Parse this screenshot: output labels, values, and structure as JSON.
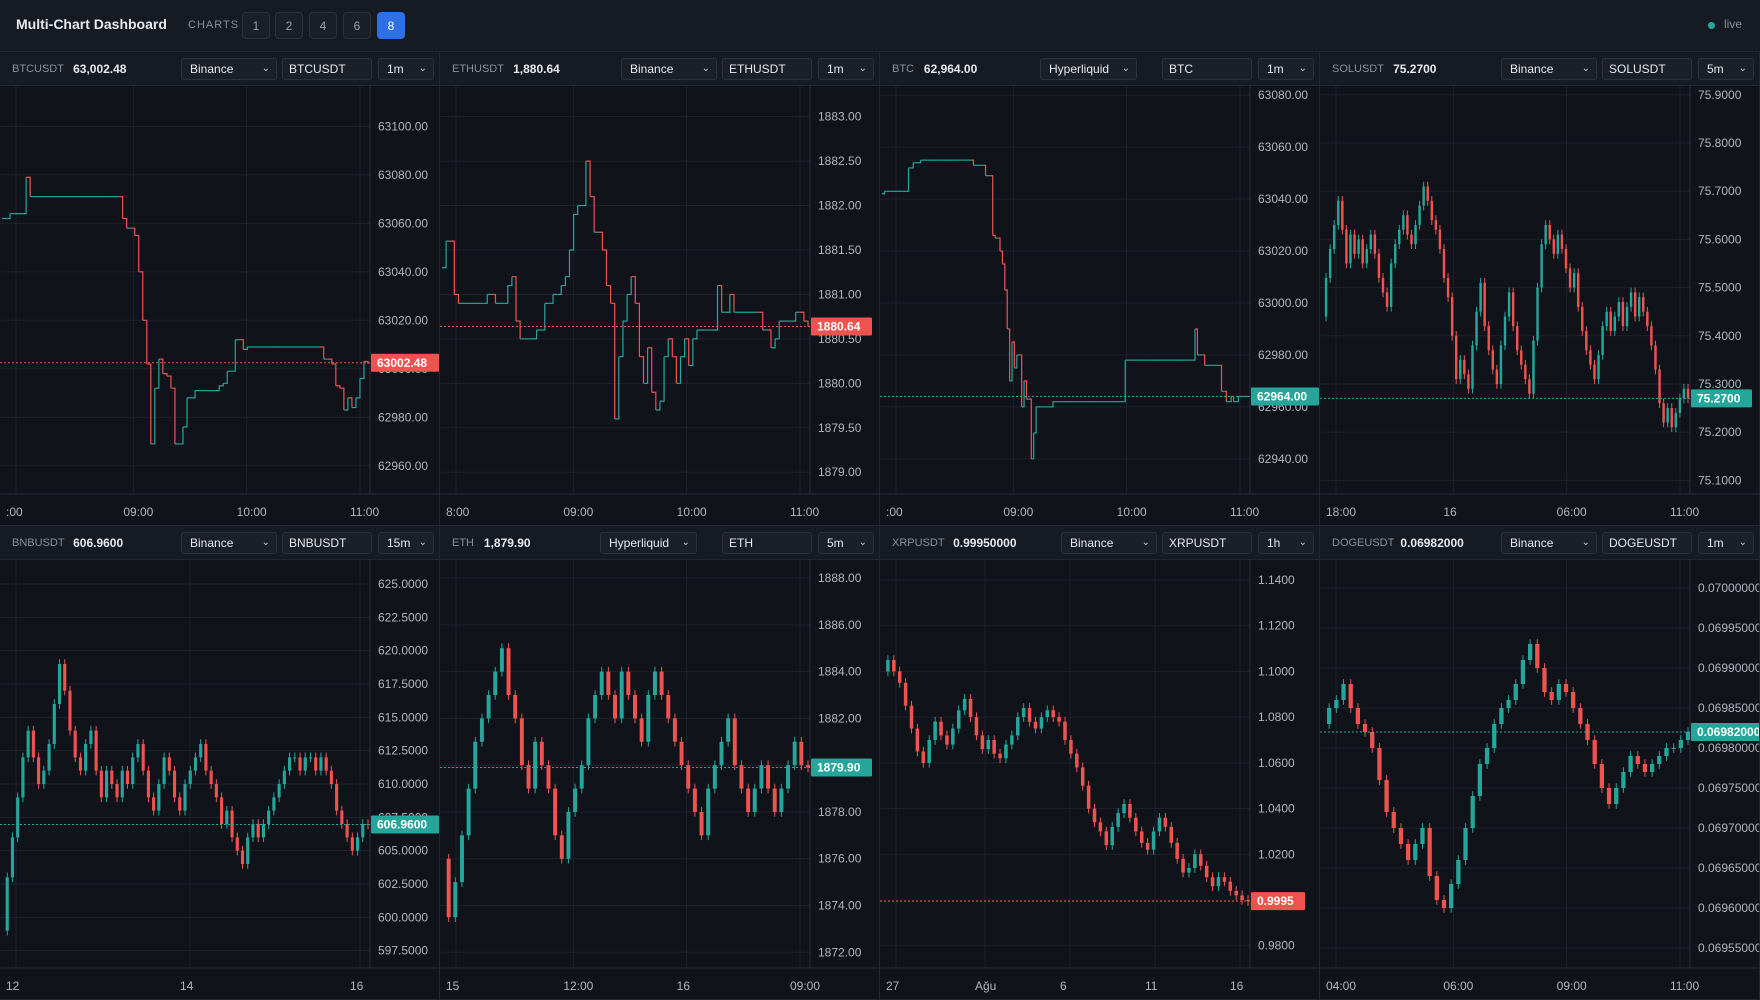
{
  "app": {
    "title": "Multi-Chart Dashboard",
    "charts_label": "CHARTS",
    "counts": [
      "1",
      "2",
      "4",
      "6",
      "8"
    ],
    "active_count": "8",
    "status": "live"
  },
  "colors": {
    "up": "#26a69a",
    "down": "#ef5350",
    "bg": "#10131a",
    "grid": "#1e222d",
    "axis_text": "#b2b5be",
    "accent": "#2f6fe8"
  },
  "chart_data": [
    {
      "type": "line",
      "style": "step",
      "symbol": "BTCUSDT",
      "last": "63,002.48",
      "exchange": "Binance",
      "input": "BTCUSDT",
      "timeframe": "1m",
      "y_ticks": [
        "63100.00",
        "63080.00",
        "63060.00",
        "63040.00",
        "63020.00",
        "63000.00",
        "62980.00",
        "62960.00"
      ],
      "ylim": [
        62950,
        63115
      ],
      "x_ticks": [
        ":00",
        "09:00",
        "10:00",
        "11:00"
      ],
      "price_label": "63002.48",
      "price_value": 63002.48,
      "price_dir": "down",
      "values": [
        63062,
        63062,
        63064,
        63064,
        63064,
        63064,
        63079,
        63071,
        63071,
        63071,
        63071,
        63071,
        63071,
        63071,
        63071,
        63071,
        63071,
        63071,
        63071,
        63071,
        63071,
        63071,
        63071,
        63071,
        63071,
        63071,
        63071,
        63071,
        63071,
        63071,
        63062,
        63058,
        63058,
        63055,
        63040,
        63020,
        63002,
        62969,
        62992,
        63004,
        62998,
        62997,
        62992,
        62969,
        62969,
        62976,
        62988,
        62988,
        62991,
        62991,
        62991,
        62991,
        62991,
        62991,
        62993,
        62994,
        62999,
        62999,
        63012,
        63012,
        63008,
        63009,
        63009,
        63009,
        63009,
        63009,
        63009,
        63009,
        63009,
        63009,
        63009,
        63009,
        63009,
        63009,
        63009,
        63009,
        63009,
        63009,
        63009,
        63009,
        63004,
        63004,
        63002,
        62993,
        62992,
        62983,
        62988,
        62984,
        62988,
        62996,
        63003,
        63002
      ]
    },
    {
      "type": "line",
      "style": "step",
      "symbol": "ETHUSDT",
      "last": "1,880.64",
      "exchange": "Binance",
      "input": "ETHUSDT",
      "timeframe": "1m",
      "y_ticks": [
        "1883.00",
        "1882.50",
        "1882.00",
        "1881.50",
        "1881.00",
        "1880.50",
        "1880.00",
        "1879.50",
        "1879.00"
      ],
      "ylim": [
        1878.8,
        1883.3
      ],
      "x_ticks": [
        "8:00",
        "09:00",
        "10:00",
        "11:00"
      ],
      "price_label": "1880.64",
      "price_value": 1880.64,
      "price_dir": "down",
      "values": [
        1881.3,
        1881.6,
        1881.6,
        1881.0,
        1880.9,
        1880.9,
        1880.9,
        1880.9,
        1880.9,
        1880.9,
        1880.9,
        1881.0,
        1881.0,
        1880.9,
        1880.9,
        1880.9,
        1881.1,
        1881.2,
        1880.7,
        1880.5,
        1880.5,
        1880.5,
        1880.5,
        1880.6,
        1880.6,
        1880.9,
        1880.9,
        1881.0,
        1881.0,
        1881.1,
        1881.2,
        1881.5,
        1881.9,
        1882.0,
        1882.0,
        1882.5,
        1882.1,
        1881.7,
        1881.7,
        1881.5,
        1881.1,
        1880.9,
        1879.6,
        1880.3,
        1880.7,
        1881.0,
        1881.2,
        1880.9,
        1880.3,
        1880.0,
        1880.4,
        1879.9,
        1879.7,
        1879.8,
        1880.3,
        1880.5,
        1880.3,
        1880.0,
        1880.3,
        1880.5,
        1880.2,
        1880.5,
        1880.6,
        1880.6,
        1880.6,
        1880.6,
        1880.6,
        1881.1,
        1880.8,
        1880.8,
        1881.0,
        1880.8,
        1880.8,
        1880.8,
        1880.8,
        1880.8,
        1880.8,
        1880.8,
        1880.6,
        1880.6,
        1880.4,
        1880.5,
        1880.7,
        1880.7,
        1880.7,
        1880.7,
        1880.8,
        1880.8,
        1880.7,
        1880.64
      ]
    },
    {
      "type": "line",
      "style": "step",
      "symbol": "BTC",
      "last": "62,964.00",
      "exchange": "Hyperliquid",
      "input": "BTC",
      "timeframe": "1m",
      "y_ticks": [
        "63080.00",
        "63060.00",
        "63040.00",
        "63020.00",
        "63000.00",
        "62980.00",
        "62960.00",
        "62940.00"
      ],
      "ylim": [
        62928,
        63082
      ],
      "x_ticks": [
        ":00",
        "09:00",
        "10:00",
        "11:00"
      ],
      "price_label": "62964.00",
      "price_value": 62964.0,
      "price_dir": "up",
      "values": [
        63042,
        63043,
        63043,
        63043,
        63043,
        63043,
        63043,
        63043,
        63043,
        63043,
        63043,
        63052,
        63052,
        63054,
        63054,
        63054,
        63055,
        63055,
        63055,
        63055,
        63055,
        63055,
        63055,
        63055,
        63055,
        63055,
        63055,
        63055,
        63055,
        63055,
        63055,
        63055,
        63055,
        63055,
        63055,
        63055,
        63055,
        63055,
        63053,
        63053,
        63053,
        63053,
        63053,
        63049,
        63049,
        63049,
        63026,
        63025,
        63025,
        63020,
        63015,
        63005,
        62990,
        62970,
        62985,
        62975,
        62980,
        62980,
        62960,
        62970,
        62963,
        62963,
        62940,
        62950,
        62960,
        62960,
        62960,
        62960,
        62960,
        62960,
        62960,
        62962,
        62962,
        62962,
        62962,
        62962,
        62962,
        62962,
        62962,
        62962,
        62962,
        62962,
        62962,
        62962,
        62962,
        62962,
        62962,
        62962,
        62962,
        62962,
        62962,
        62962,
        62962,
        62962,
        62962,
        62962,
        62962,
        62962,
        62962,
        62962,
        62962,
        62978,
        62978,
        62978,
        62978,
        62978,
        62978,
        62978,
        62978,
        62978,
        62978,
        62978,
        62978,
        62978,
        62978,
        62978,
        62978,
        62978,
        62978,
        62978,
        62978,
        62978,
        62978,
        62978,
        62978,
        62978,
        62978,
        62978,
        62978,
        62978,
        62990,
        62980,
        62980,
        62980,
        62976,
        62976,
        62976,
        62976,
        62976,
        62976,
        62976,
        62966,
        62966,
        62962,
        62962,
        62964,
        62962,
        62962,
        62964,
        62964,
        62964,
        62964,
        62964
      ]
    },
    {
      "type": "line",
      "style": "bars",
      "symbol": "SOLUSDT",
      "last": "75.2700",
      "exchange": "Binance",
      "input": "SOLUSDT",
      "timeframe": "5m",
      "y_ticks": [
        "75.9000",
        "75.8000",
        "75.7000",
        "75.6000",
        "75.5000",
        "75.4000",
        "75.3000",
        "75.2000",
        "75.1000"
      ],
      "ylim": [
        75.08,
        75.91
      ],
      "x_ticks": [
        "18:00",
        "16",
        "06:00",
        "11:00"
      ],
      "price_label": "75.2700",
      "price_value": 75.27,
      "price_dir": "up",
      "values": [
        75.44,
        75.52,
        75.58,
        75.63,
        75.68,
        75.62,
        75.55,
        75.61,
        75.57,
        75.6,
        75.55,
        75.58,
        75.61,
        75.57,
        75.52,
        75.49,
        75.46,
        75.55,
        75.59,
        75.62,
        75.65,
        75.61,
        75.59,
        75.63,
        75.67,
        75.71,
        75.68,
        75.64,
        75.62,
        75.58,
        75.52,
        75.48,
        75.4,
        75.31,
        75.35,
        75.32,
        75.29,
        75.38,
        75.45,
        75.51,
        75.42,
        75.37,
        75.33,
        75.3,
        75.38,
        75.44,
        75.49,
        75.42,
        75.37,
        75.34,
        75.31,
        75.28,
        75.39,
        75.5,
        75.59,
        75.63,
        75.6,
        75.57,
        75.61,
        75.58,
        75.54,
        75.5,
        75.53,
        75.46,
        75.41,
        75.37,
        75.34,
        75.31,
        75.36,
        75.42,
        75.45,
        75.41,
        75.44,
        75.47,
        75.42,
        75.46,
        75.49,
        75.44,
        75.48,
        75.45,
        75.42,
        75.38,
        75.33,
        75.26,
        75.22,
        75.25,
        75.21,
        75.24,
        75.27,
        75.29,
        75.27
      ]
    },
    {
      "type": "line",
      "style": "bars",
      "symbol": "BNBUSDT",
      "last": "606.9600",
      "exchange": "Binance",
      "input": "BNBUSDT",
      "timeframe": "15m",
      "y_ticks": [
        "625.0000",
        "622.5000",
        "620.0000",
        "617.5000",
        "615.0000",
        "612.5000",
        "610.0000",
        "607.5000",
        "605.0000",
        "602.5000",
        "600.0000",
        "597.5000"
      ],
      "ylim": [
        596.5,
        626.5
      ],
      "x_ticks": [
        "12",
        "14",
        "16"
      ],
      "price_label": "606.9600",
      "price_value": 606.96,
      "price_dir": "up",
      "values": [
        599,
        603,
        606,
        609,
        612,
        614,
        612,
        610,
        611,
        613,
        616,
        619,
        617,
        614,
        612,
        611,
        613,
        614,
        611,
        609,
        611,
        610,
        609,
        611,
        610,
        612,
        613,
        611,
        609,
        608,
        610,
        612,
        611,
        609,
        608,
        610,
        611,
        612,
        613,
        611,
        610,
        609,
        607,
        608,
        606,
        605,
        604,
        606,
        607,
        606,
        607,
        608,
        609,
        610,
        611,
        612,
        612,
        611,
        612,
        612,
        611,
        612,
        611,
        610,
        608,
        607,
        606,
        605,
        606,
        607,
        606.96
      ]
    },
    {
      "type": "line",
      "style": "bars",
      "symbol": "ETH",
      "last": "1,879.90",
      "exchange": "Hyperliquid",
      "input": "ETH",
      "timeframe": "5m",
      "y_ticks": [
        "1888.00",
        "1886.00",
        "1884.00",
        "1882.00",
        "1880.00",
        "1878.00",
        "1876.00",
        "1874.00",
        "1872.00"
      ],
      "ylim": [
        1871.5,
        1888.6
      ],
      "x_ticks": [
        "15",
        "12:00",
        "16",
        "09:00"
      ],
      "price_label": "1879.90",
      "price_value": 1879.9,
      "price_dir": "up",
      "values": [
        1876,
        1873.5,
        1875,
        1877,
        1879,
        1881,
        1882,
        1883,
        1884,
        1885,
        1883,
        1882,
        1880,
        1879,
        1881,
        1880,
        1879,
        1877,
        1876,
        1878,
        1879,
        1880,
        1882,
        1883,
        1884,
        1883,
        1882,
        1884,
        1883,
        1882,
        1881,
        1883,
        1884,
        1883,
        1882,
        1881,
        1880,
        1879,
        1878,
        1877,
        1879,
        1880,
        1881,
        1882,
        1880,
        1879,
        1878,
        1879,
        1880,
        1879,
        1878,
        1879,
        1880,
        1881,
        1880,
        1879.9
      ]
    },
    {
      "type": "line",
      "style": "bars",
      "symbol": "XRPUSDT",
      "last": "0.99950000",
      "exchange": "Binance",
      "input": "XRPUSDT",
      "timeframe": "1h",
      "y_ticks": [
        "1.1400",
        "1.1200",
        "1.1000",
        "1.0800",
        "1.0600",
        "1.0400",
        "1.0200",
        "1.0000",
        "0.9800"
      ],
      "ylim": [
        0.972,
        1.147
      ],
      "x_ticks": [
        "27",
        "Ağu",
        "6",
        "11",
        "16"
      ],
      "price_label": "0.9995",
      "price_value": 0.9995,
      "price_dir": "down",
      "values": [
        1.1,
        1.105,
        1.1,
        1.095,
        1.085,
        1.075,
        1.065,
        1.06,
        1.07,
        1.078,
        1.072,
        1.068,
        1.075,
        1.083,
        1.088,
        1.08,
        1.072,
        1.066,
        1.07,
        1.064,
        1.062,
        1.068,
        1.072,
        1.08,
        1.084,
        1.078,
        1.075,
        1.08,
        1.083,
        1.08,
        1.078,
        1.07,
        1.064,
        1.058,
        1.05,
        1.04,
        1.034,
        1.03,
        1.024,
        1.032,
        1.038,
        1.042,
        1.036,
        1.03,
        1.025,
        1.022,
        1.03,
        1.036,
        1.032,
        1.025,
        1.018,
        1.012,
        1.014,
        1.02,
        1.015,
        1.01,
        1.006,
        1.01,
        1.008,
        1.004,
        1.002,
        1.0,
        0.9995
      ]
    },
    {
      "type": "line",
      "style": "bars",
      "symbol": "DOGEUSDT",
      "last": "0.06982000",
      "exchange": "Binance",
      "input": "DOGEUSDT",
      "timeframe": "1m",
      "y_ticks": [
        "0.07000000",
        "0.06995000",
        "0.06990000",
        "0.06985000",
        "0.06980000",
        "0.06975000",
        "0.06970000",
        "0.06965000",
        "0.06960000",
        "0.06955000"
      ],
      "ylim": [
        0.06953,
        0.07003
      ],
      "x_ticks": [
        "04:00",
        "06:00",
        "09:00",
        "11:00"
      ],
      "price_label": "0.06982000",
      "price_value": 0.06982,
      "price_dir": "up",
      "values": [
        0.06983,
        0.06985,
        0.06986,
        0.06988,
        0.06985,
        0.06983,
        0.06982,
        0.0698,
        0.06976,
        0.06972,
        0.0697,
        0.06968,
        0.06966,
        0.06968,
        0.0697,
        0.06964,
        0.06961,
        0.0696,
        0.06963,
        0.06966,
        0.0697,
        0.06974,
        0.06978,
        0.0698,
        0.06983,
        0.06985,
        0.06986,
        0.06988,
        0.06991,
        0.06993,
        0.0699,
        0.06987,
        0.06986,
        0.06988,
        0.06987,
        0.06985,
        0.06983,
        0.06981,
        0.06978,
        0.06975,
        0.06973,
        0.06975,
        0.06977,
        0.06979,
        0.06978,
        0.06977,
        0.06978,
        0.06979,
        0.0698,
        0.0698,
        0.06981,
        0.06982
      ]
    }
  ]
}
